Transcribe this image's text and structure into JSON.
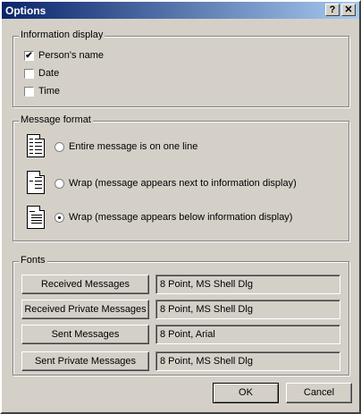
{
  "window": {
    "title": "Options",
    "help_label": "?",
    "close_label": "✕"
  },
  "information_display": {
    "legend": "Information display",
    "items": [
      {
        "label": "Person's name",
        "checked": true,
        "mark": "✔"
      },
      {
        "label": "Date",
        "checked": false,
        "mark": ""
      },
      {
        "label": "Time",
        "checked": false,
        "mark": ""
      }
    ]
  },
  "message_format": {
    "legend": "Message format",
    "options": [
      {
        "label": "Entire message is on one line",
        "selected": false,
        "icon": "one-line-doc-icon"
      },
      {
        "label": "Wrap (message appears next to information display)",
        "selected": false,
        "icon": "wrap-next-doc-icon"
      },
      {
        "label": "Wrap (message appears below information display)",
        "selected": true,
        "icon": "wrap-below-doc-icon"
      }
    ]
  },
  "fonts": {
    "legend": "Fonts",
    "rows": [
      {
        "button": "Received Messages",
        "value": "8 Point, MS Shell Dlg"
      },
      {
        "button": "Received Private Messages",
        "value": "8 Point, MS Shell Dlg"
      },
      {
        "button": "Sent Messages",
        "value": "8 Point, Arial"
      },
      {
        "button": "Sent Private Messages",
        "value": "8 Point, MS Shell Dlg"
      }
    ]
  },
  "actions": {
    "ok_label": "OK",
    "cancel_label": "Cancel"
  }
}
